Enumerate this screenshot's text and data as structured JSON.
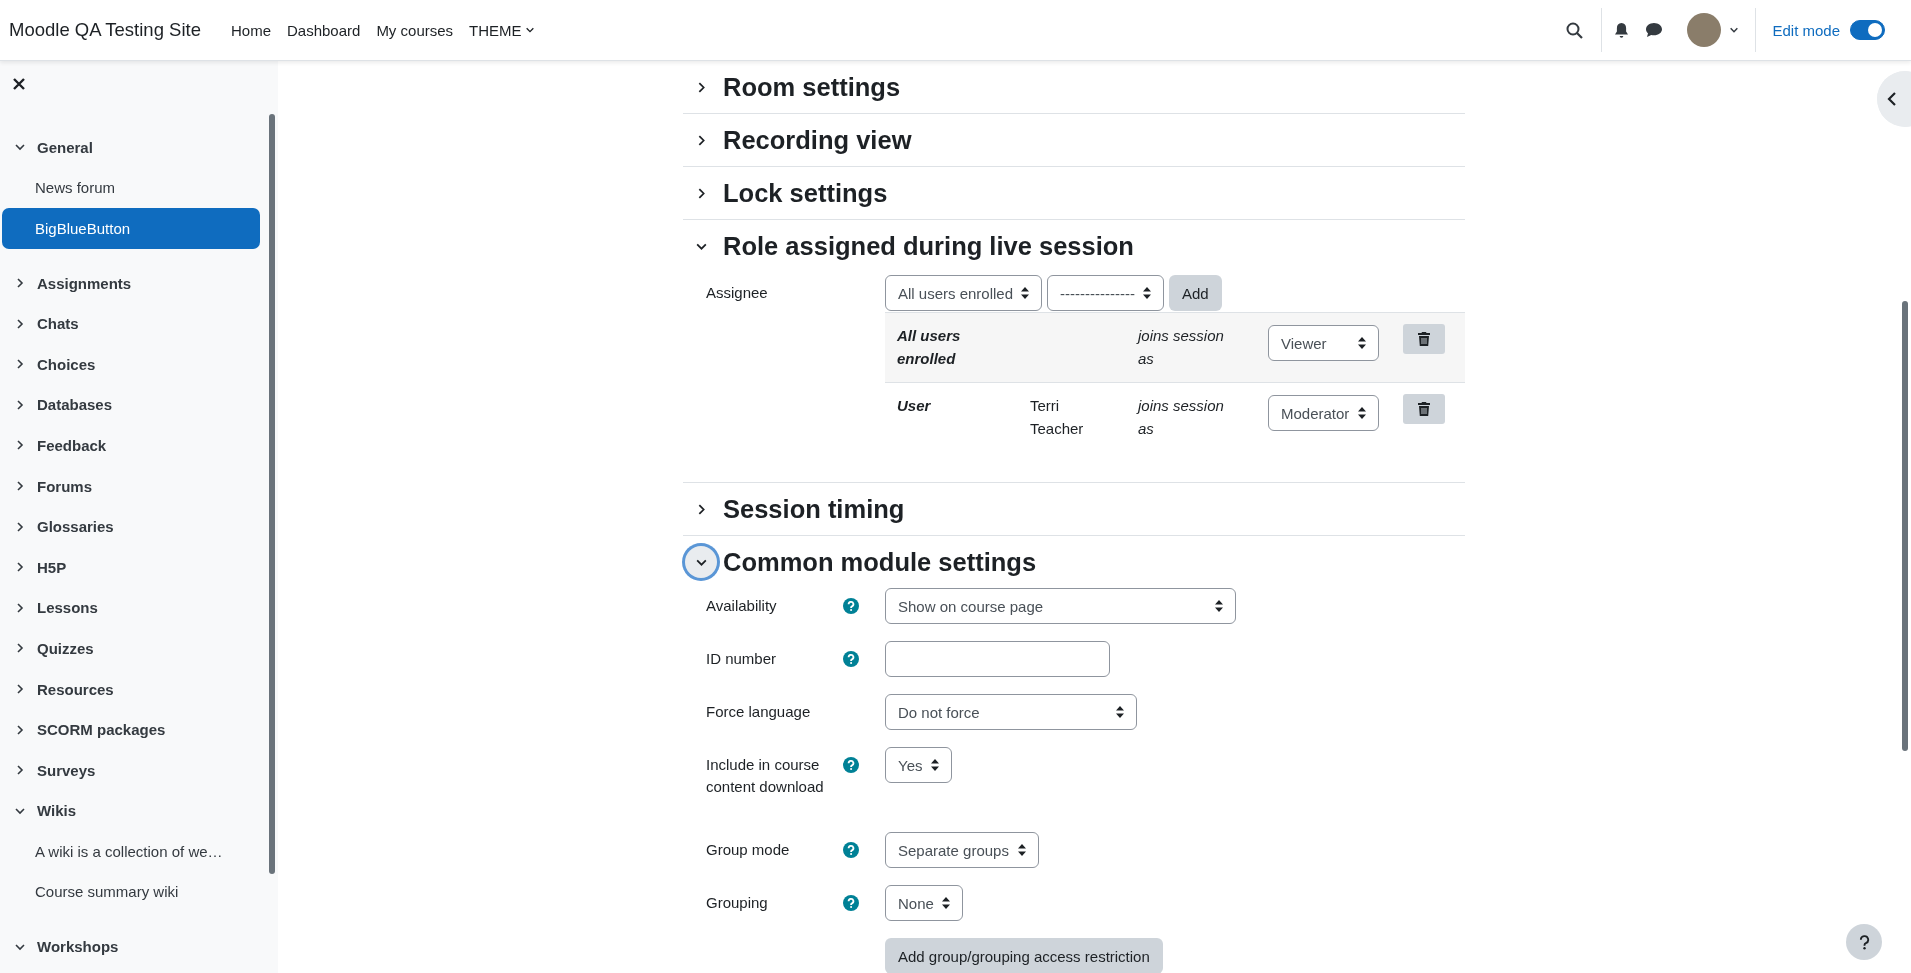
{
  "navbar": {
    "site_name": "Moodle QA Testing Site",
    "menu": [
      {
        "label": "Home",
        "kind": "link"
      },
      {
        "label": "Dashboard",
        "kind": "link"
      },
      {
        "label": "My courses",
        "kind": "link"
      },
      {
        "label": "THEME",
        "kind": "dropdown"
      }
    ],
    "edit_mode": {
      "label": "Edit mode",
      "on": true
    }
  },
  "course_index": {
    "items": [
      {
        "label": "General",
        "expanded": true,
        "selected": false,
        "children": [
          {
            "label": "News forum",
            "selected": false
          },
          {
            "label": "BigBlueButton",
            "selected": true
          }
        ]
      },
      {
        "label": "Assignments",
        "expanded": false,
        "selected": false
      },
      {
        "label": "Chats",
        "expanded": false,
        "selected": false
      },
      {
        "label": "Choices",
        "expanded": false,
        "selected": false
      },
      {
        "label": "Databases",
        "expanded": false,
        "selected": false
      },
      {
        "label": "Feedback",
        "expanded": false,
        "selected": false
      },
      {
        "label": "Forums",
        "expanded": false,
        "selected": false
      },
      {
        "label": "Glossaries",
        "expanded": false,
        "selected": false
      },
      {
        "label": "H5P",
        "expanded": false,
        "selected": false
      },
      {
        "label": "Lessons",
        "expanded": false,
        "selected": false
      },
      {
        "label": "Quizzes",
        "expanded": false,
        "selected": false
      },
      {
        "label": "Resources",
        "expanded": false,
        "selected": false
      },
      {
        "label": "SCORM packages",
        "expanded": false,
        "selected": false
      },
      {
        "label": "Surveys",
        "expanded": false,
        "selected": false
      },
      {
        "label": "Wikis",
        "expanded": true,
        "selected": false,
        "children": [
          {
            "label": "A wiki is a collection of we…",
            "selected": false
          },
          {
            "label": "Course summary wiki",
            "selected": false
          }
        ]
      },
      {
        "label": "Workshops",
        "expanded": true,
        "selected": false
      }
    ]
  },
  "sections": [
    {
      "title": "Room settings",
      "expanded": false,
      "focused": false
    },
    {
      "title": "Recording view",
      "expanded": false,
      "focused": false
    },
    {
      "title": "Lock settings",
      "expanded": false,
      "focused": false
    },
    {
      "title": "Role assigned during live session",
      "expanded": true,
      "focused": false,
      "kind": "roles",
      "assignee": {
        "label": "Assignee",
        "type_select": "All users enrolled",
        "user_select": "---------------",
        "add_button": "Add"
      },
      "participants": [
        {
          "type": "All users enrolled",
          "joins": "joins session as",
          "role": "Viewer"
        },
        {
          "type": "User",
          "name": "Terri Teacher",
          "joins": "joins session as",
          "role": "Moderator"
        }
      ]
    },
    {
      "title": "Session timing",
      "expanded": false,
      "focused": false
    },
    {
      "title": "Common module settings",
      "expanded": true,
      "focused": true,
      "kind": "fields",
      "fields": [
        {
          "label": "Availability",
          "help": true,
          "kind": "select",
          "value": "Show on course page"
        },
        {
          "label": "ID number",
          "help": true,
          "kind": "text"
        },
        {
          "label": "Force language",
          "help": false,
          "kind": "select",
          "value": "Do not force"
        },
        {
          "label": "Include in course content download",
          "help": true,
          "kind": "select",
          "value": "Yes"
        },
        {
          "label": "Group mode",
          "help": true,
          "kind": "select",
          "value": "Separate groups"
        },
        {
          "label": "Grouping",
          "help": true,
          "kind": "select",
          "value": "None"
        },
        {
          "kind": "button",
          "value": "Add group/grouping access restriction"
        }
      ]
    }
  ]
}
